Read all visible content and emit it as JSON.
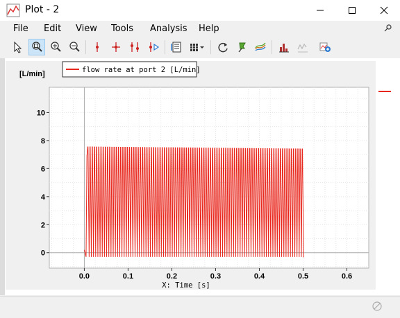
{
  "window": {
    "title": "Plot - 2"
  },
  "menu": {
    "file": "File",
    "edit": "Edit",
    "view": "View",
    "tools": "Tools",
    "analysis": "Analysis",
    "help": "Help"
  },
  "toolbar": {
    "icons": [
      "pointer-icon",
      "zoom-fit-icon",
      "zoom-in-icon",
      "zoom-out-icon",
      "marker-icon",
      "crosshair-icon",
      "double-marker-icon",
      "marker-arrow-icon",
      "data-table-icon",
      "grid-menu-icon",
      "refresh-icon",
      "pin-marker-icon",
      "curves-icon",
      "bar-chart-icon",
      "filter-icon",
      "add-plot-icon"
    ]
  },
  "plot": {
    "ylabel_unit": "[L/min]",
    "xlabel": "X: Time [s]",
    "legend": "flow rate at port 2 [L/min]",
    "line_color": "#e8261c"
  },
  "chart_data": {
    "type": "line",
    "xlabel": "X: Time [s]",
    "ylabel": "[L/min]",
    "xlim": [
      -0.08,
      0.65
    ],
    "ylim": [
      -1.1,
      11.8
    ],
    "xticks": [
      "0.0",
      "0.1",
      "0.2",
      "0.3",
      "0.4",
      "0.5",
      "0.6"
    ],
    "yticks": [
      "0",
      "2",
      "4",
      "6",
      "8",
      "10"
    ],
    "grid": true,
    "legend_position": "top-left",
    "series": [
      {
        "name": "flow rate at port 2 [L/min]",
        "color": "#e8261c",
        "description_points": [
          [
            0.0,
            0.2
          ],
          [
            0.004,
            -0.3
          ],
          [
            0.006,
            6.9
          ],
          [
            0.012,
            7.6
          ],
          [
            0.5,
            7.4
          ],
          [
            0.5,
            -0.3
          ]
        ],
        "oscillation": {
          "start": 0.006,
          "end": 0.5,
          "period": 0.005,
          "high": 7.55,
          "low": -0.3
        }
      }
    ]
  }
}
